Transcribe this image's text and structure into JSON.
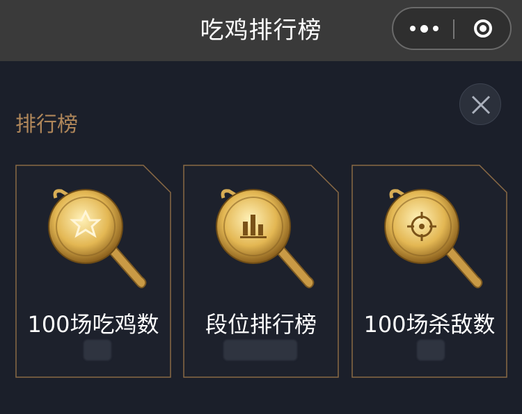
{
  "navbar": {
    "title": "吃鸡排行榜",
    "more_icon": "more-dots-icon",
    "close_icon": "target-circle-icon"
  },
  "section": {
    "title": "排行榜",
    "close_icon": "close-icon"
  },
  "cards": [
    {
      "label": "100场吃鸡数",
      "icon": "star-pan-icon"
    },
    {
      "label": "段位排行榜",
      "icon": "bar-chart-pan-icon"
    },
    {
      "label": "100场杀敌数",
      "icon": "crosshair-pan-icon"
    }
  ],
  "colors": {
    "background": "#1b1f2a",
    "navbar": "#3a3a3a",
    "accent_gold": "#b0875a",
    "card_border": "#8a6a45"
  }
}
